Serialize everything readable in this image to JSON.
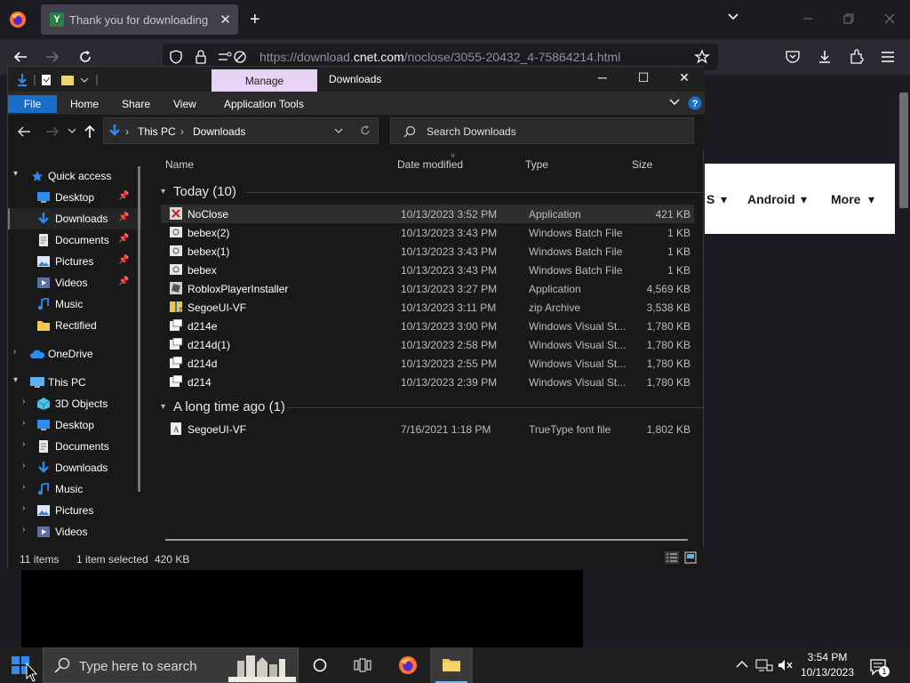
{
  "browser": {
    "tab_title": "Thank you for downloading No",
    "tab_favicon": "Y",
    "url_prefix": "https://download.",
    "url_domain": "cnet.com",
    "url_path": "/noclose/3055-20432_4-75864214.html",
    "new_tab": "+"
  },
  "webpage": {
    "nav_items": [
      "S",
      "Android",
      "More"
    ],
    "accent": "#ffffff"
  },
  "explorer": {
    "manage_tab": "Manage",
    "window_title": "Downloads",
    "ribbon": {
      "file": "File",
      "home": "Home",
      "share": "Share",
      "view": "View",
      "app_tools": "Application Tools"
    },
    "breadcrumb": [
      "This PC",
      "Downloads"
    ],
    "search_placeholder": "Search Downloads",
    "nav": {
      "quick_access": "Quick access",
      "quick_items": [
        {
          "label": "Desktop",
          "icon": "desktop-icon"
        },
        {
          "label": "Downloads",
          "icon": "downloads-icon"
        },
        {
          "label": "Documents",
          "icon": "documents-icon"
        },
        {
          "label": "Pictures",
          "icon": "pictures-icon"
        },
        {
          "label": "Videos",
          "icon": "videos-icon"
        },
        {
          "label": "Music",
          "icon": "music-icon"
        },
        {
          "label": "Rectified",
          "icon": "folder-icon"
        }
      ],
      "onedrive": "OneDrive",
      "this_pc": "This PC",
      "pc_items": [
        {
          "label": "3D Objects",
          "icon": "3d-objects-icon"
        },
        {
          "label": "Desktop",
          "icon": "desktop-icon"
        },
        {
          "label": "Documents",
          "icon": "documents-icon"
        },
        {
          "label": "Downloads",
          "icon": "downloads-icon"
        },
        {
          "label": "Music",
          "icon": "music-icon"
        },
        {
          "label": "Pictures",
          "icon": "pictures-icon"
        },
        {
          "label": "Videos",
          "icon": "videos-icon"
        }
      ]
    },
    "columns": {
      "name": "Name",
      "date": "Date modified",
      "type": "Type",
      "size": "Size"
    },
    "groups": [
      {
        "label": "Today (10)",
        "files": [
          {
            "name": "NoClose",
            "date": "10/13/2023 3:52 PM",
            "type": "Application",
            "size": "421 KB",
            "icon": "app-icon",
            "selected": true
          },
          {
            "name": "bebex(2)",
            "date": "10/13/2023 3:43 PM",
            "type": "Windows Batch File",
            "size": "1 KB",
            "icon": "batch-file-icon"
          },
          {
            "name": "bebex(1)",
            "date": "10/13/2023 3:43 PM",
            "type": "Windows Batch File",
            "size": "1 KB",
            "icon": "batch-file-icon"
          },
          {
            "name": "bebex",
            "date": "10/13/2023 3:43 PM",
            "type": "Windows Batch File",
            "size": "1 KB",
            "icon": "batch-file-icon"
          },
          {
            "name": "RobloxPlayerInstaller",
            "date": "10/13/2023 3:27 PM",
            "type": "Application",
            "size": "4,569 KB",
            "icon": "roblox-icon"
          },
          {
            "name": "SegoeUI-VF",
            "date": "10/13/2023 3:11 PM",
            "type": "zip Archive",
            "size": "3,538 KB",
            "icon": "zip-icon"
          },
          {
            "name": "d214e",
            "date": "10/13/2023 3:00 PM",
            "type": "Windows Visual St...",
            "size": "1,780 KB",
            "icon": "vs-file-icon"
          },
          {
            "name": "d214d(1)",
            "date": "10/13/2023 2:58 PM",
            "type": "Windows Visual St...",
            "size": "1,780 KB",
            "icon": "vs-file-icon"
          },
          {
            "name": "d214d",
            "date": "10/13/2023 2:55 PM",
            "type": "Windows Visual St...",
            "size": "1,780 KB",
            "icon": "vs-file-icon"
          },
          {
            "name": "d214",
            "date": "10/13/2023 2:39 PM",
            "type": "Windows Visual St...",
            "size": "1,780 KB",
            "icon": "vs-file-icon"
          }
        ]
      },
      {
        "label": "A long time ago (1)",
        "files": [
          {
            "name": "SegoeUI-VF",
            "date": "7/16/2021 1:18 PM",
            "type": "TrueType font file",
            "size": "1,802 KB",
            "icon": "font-file-icon"
          }
        ]
      }
    ],
    "status": {
      "items": "11 items",
      "selected": "1 item selected",
      "size": "420 KB"
    }
  },
  "taskbar": {
    "search_placeholder": "Type here to search",
    "time": "3:54 PM",
    "date": "10/13/2023",
    "notifications": "1"
  }
}
